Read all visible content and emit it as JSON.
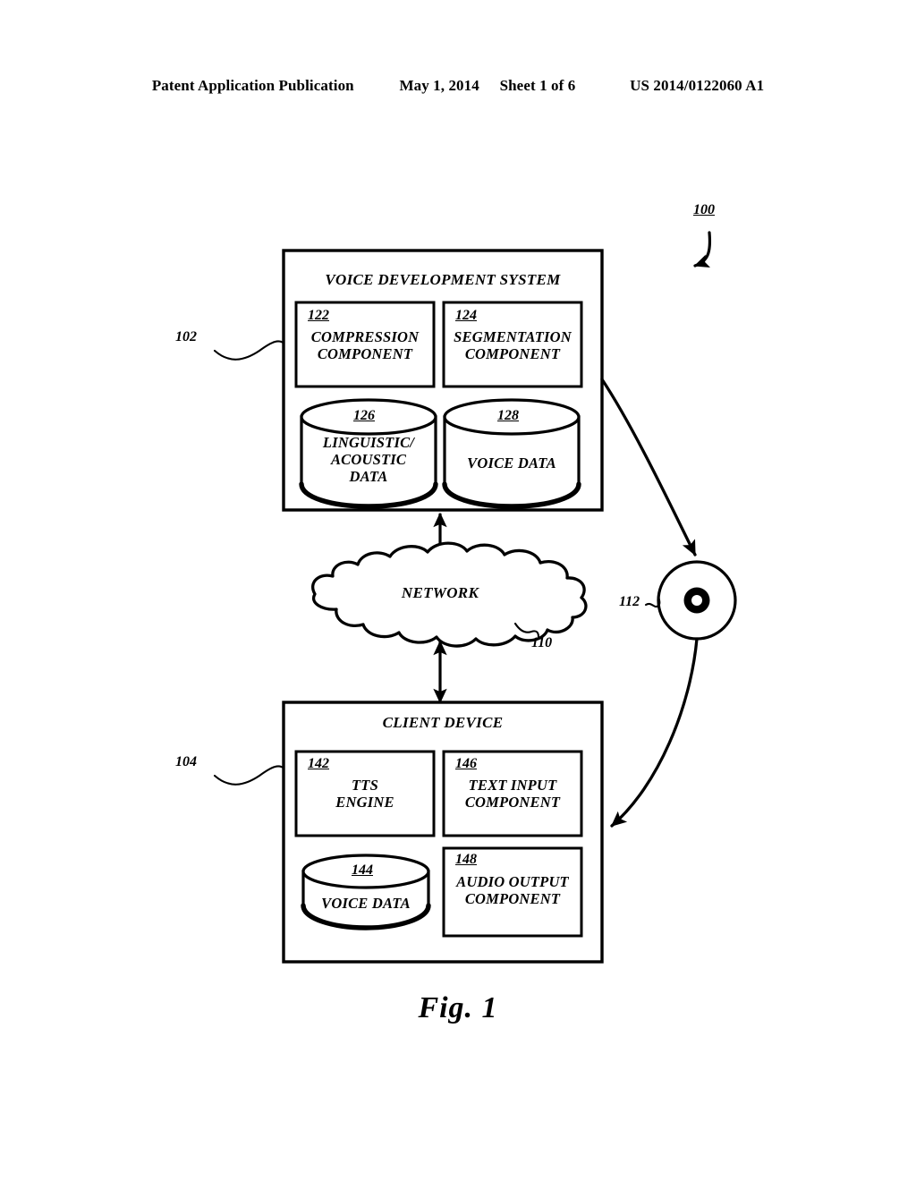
{
  "header": {
    "publication": "Patent Application Publication",
    "date": "May 1, 2014",
    "sheet": "Sheet 1 of 6",
    "patent_number": "US 2014/0122060 A1"
  },
  "figure": {
    "caption": "Fig. 1",
    "system_ref": "100"
  },
  "voice_development_system": {
    "ref": "102",
    "title": "VOICE DEVELOPMENT SYSTEM",
    "components": [
      {
        "ref": "122",
        "label": "COMPRESSION\nCOMPONENT",
        "shape": "box"
      },
      {
        "ref": "124",
        "label": "SEGMENTATION\nCOMPONENT",
        "shape": "box"
      },
      {
        "ref": "126",
        "label": "LINGUISTIC/\nACOUSTIC\nDATA",
        "shape": "cylinder"
      },
      {
        "ref": "128",
        "label": "VOICE DATA",
        "shape": "cylinder"
      }
    ]
  },
  "network": {
    "ref": "110",
    "label": "NETWORK",
    "shape": "cloud"
  },
  "media": {
    "ref": "112",
    "label": "",
    "shape": "disc"
  },
  "client_device": {
    "ref": "104",
    "title": "CLIENT DEVICE",
    "components": [
      {
        "ref": "142",
        "label": "TTS\nENGINE",
        "shape": "box"
      },
      {
        "ref": "146",
        "label": "TEXT INPUT\nCOMPONENT",
        "shape": "box"
      },
      {
        "ref": "144",
        "label": "VOICE DATA",
        "shape": "cylinder"
      },
      {
        "ref": "148",
        "label": "AUDIO OUTPUT\nCOMPONENT",
        "shape": "box"
      }
    ]
  },
  "colors": {
    "ink": "#000000",
    "paper": "#ffffff"
  }
}
